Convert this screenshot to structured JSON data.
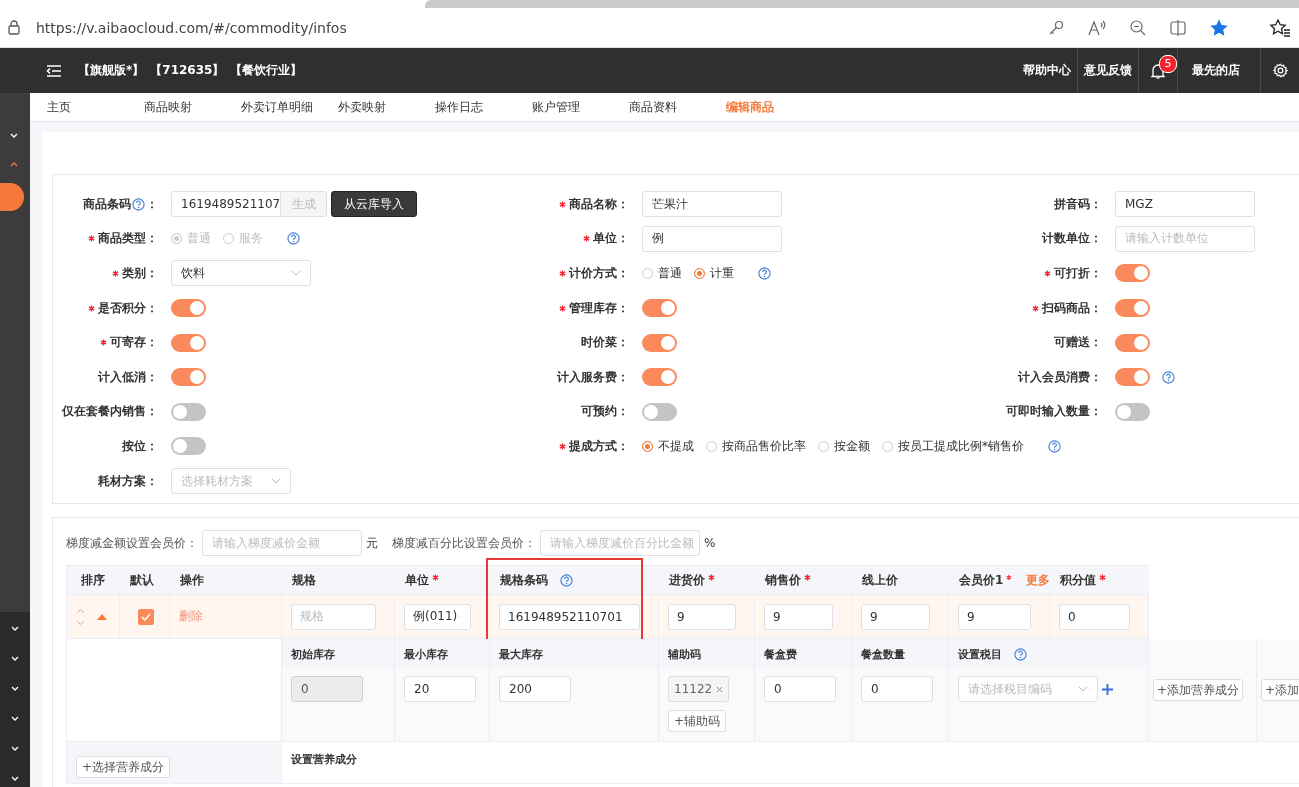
{
  "browser": {
    "url": "https://v.aibaocloud.com/#/commodity/infos"
  },
  "top_nav": {
    "badges": [
      "【旗舰版*】",
      "【712635】",
      "【餐饮行业】"
    ],
    "help": "帮助中心",
    "feedback": "意见反馈",
    "notifications": "5",
    "store": "最先的店"
  },
  "tabs": [
    {
      "label": "主页",
      "selected": false
    },
    {
      "label": "商品映射",
      "selected": false
    },
    {
      "label": "外卖订单明细",
      "selected": false
    },
    {
      "label": "外卖映射",
      "selected": false
    },
    {
      "label": "操作日志",
      "selected": false
    },
    {
      "label": "账户管理",
      "selected": false
    },
    {
      "label": "商品资料",
      "selected": false
    },
    {
      "label": "编辑商品",
      "selected": true
    }
  ],
  "form": {
    "rows": [
      {
        "fields": [
          {
            "kind": "barcode",
            "label": "商品条码",
            "label_suffix": "：",
            "help": true,
            "help_in_label": true,
            "required": false,
            "value": "1619489521107",
            "append": "生成",
            "button": "从云库导入"
          },
          {
            "kind": "text",
            "label": "商品名称：",
            "required": true,
            "value": "芒果汁"
          },
          {
            "kind": "text",
            "label": "拼音码：",
            "required": false,
            "value": "MGZ"
          }
        ]
      },
      {
        "fields": [
          {
            "kind": "radio",
            "label": "商品类型：",
            "required": true,
            "disabled": true,
            "help": true,
            "options": [
              {
                "label": "普通",
                "selected": true
              },
              {
                "label": "服务",
                "selected": false
              }
            ]
          },
          {
            "kind": "text",
            "label": "单位：",
            "required": true,
            "value": "例"
          },
          {
            "kind": "text",
            "label": "计数单位：",
            "required": false,
            "placeholder": "请输入计数单位"
          }
        ]
      },
      {
        "fields": [
          {
            "kind": "select",
            "label": "类别：",
            "required": true,
            "value": "饮料"
          },
          {
            "kind": "radio",
            "label": "计价方式：",
            "required": true,
            "disabled": false,
            "help": true,
            "options": [
              {
                "label": "普通",
                "selected": false
              },
              {
                "label": "计重",
                "selected": true
              }
            ]
          },
          {
            "kind": "toggle",
            "label": "可打折：",
            "required": true,
            "on": true
          }
        ]
      },
      {
        "fields": [
          {
            "kind": "toggle",
            "label": "是否积分：",
            "required": true,
            "on": true
          },
          {
            "kind": "toggle",
            "label": "管理库存：",
            "required": true,
            "on": true
          },
          {
            "kind": "toggle",
            "label": "扫码商品：",
            "required": true,
            "on": true
          }
        ]
      },
      {
        "fields": [
          {
            "kind": "toggle",
            "label": "可寄存：",
            "required": true,
            "on": true
          },
          {
            "kind": "toggle",
            "label": "时价菜：",
            "required": false,
            "on": true
          },
          {
            "kind": "toggle",
            "label": "可赠送：",
            "required": false,
            "on": true
          }
        ]
      },
      {
        "fields": [
          {
            "kind": "toggle",
            "label": "计入低消：",
            "required": false,
            "on": true
          },
          {
            "kind": "toggle",
            "label": "计入服务费：",
            "required": false,
            "on": true
          },
          {
            "kind": "toggle",
            "label": "计入会员消费：",
            "required": false,
            "on": true,
            "help": true
          }
        ]
      },
      {
        "fields": [
          {
            "kind": "toggle",
            "label": "仅在套餐内销售：",
            "required": false,
            "on": false
          },
          {
            "kind": "toggle",
            "label": "可预约：",
            "required": false,
            "on": false
          },
          {
            "kind": "toggle",
            "label": "可即时输入数量：",
            "required": false,
            "on": false
          }
        ]
      },
      {
        "fields": [
          {
            "kind": "toggle",
            "label": "按位：",
            "required": false,
            "on": false
          },
          {
            "kind": "radio",
            "label": "提成方式：",
            "required": true,
            "disabled": false,
            "help": true,
            "options": [
              {
                "label": "不提成",
                "selected": true
              },
              {
                "label": "按商品售价比率",
                "selected": false
              },
              {
                "label": "按金额",
                "selected": false
              },
              {
                "label": "按员工提成比例*销售价",
                "selected": false
              }
            ]
          }
        ]
      },
      {
        "fields": [
          {
            "kind": "select",
            "label": "耗材方案：",
            "required": false,
            "placeholder": "选择耗材方案"
          }
        ]
      }
    ]
  },
  "tiers": {
    "amount_label": "梯度减金额设置会员价：",
    "amount_placeholder": "请输入梯度减价金额",
    "amount_unit": "元",
    "percent_label": "梯度减百分比设置会员价：",
    "percent_placeholder": "请输入梯度减价百分比金额",
    "percent_unit": "%"
  },
  "spec_table": {
    "columns": [
      {
        "label": "排序"
      },
      {
        "label": "默认"
      },
      {
        "label": "操作"
      },
      {
        "label": "规格"
      },
      {
        "label": "单位",
        "required": true
      },
      {
        "label": "规格条码",
        "help": true,
        "highlighted": true
      },
      {
        "label": "进货价",
        "required": true
      },
      {
        "label": "销售价",
        "required": true
      },
      {
        "label": "线上价"
      },
      {
        "label": "会员价1",
        "required": true,
        "link": "更多"
      },
      {
        "label": "积分值",
        "required": true
      }
    ],
    "rows": [
      {
        "cells": [
          {
            "kind": "sort"
          },
          {
            "kind": "check",
            "checked": true
          },
          {
            "kind": "link",
            "text": "删除"
          },
          {
            "kind": "input",
            "placeholder": "规格"
          },
          {
            "kind": "select",
            "value": "例(011)"
          },
          {
            "kind": "input",
            "value": "161948952110701"
          },
          {
            "kind": "input",
            "value": "9"
          },
          {
            "kind": "input",
            "value": "9"
          },
          {
            "kind": "input",
            "value": "9"
          },
          {
            "kind": "input",
            "value": "9"
          },
          {
            "kind": "input",
            "value": "0"
          }
        ]
      }
    ],
    "sub_columns": [
      {
        "kind": "input",
        "label": "初始库存",
        "value": "0",
        "disabled": true
      },
      {
        "kind": "input",
        "label": "最小库存",
        "value": "20",
        "disabled": false
      },
      {
        "kind": "input",
        "label": "最大库存",
        "value": "200",
        "disabled": false
      },
      {
        "kind": "tags",
        "label": "辅助码",
        "tags": [
          "11122"
        ],
        "button": "+辅助码"
      },
      {
        "kind": "input",
        "label": "餐盒费",
        "value": "0",
        "disabled": false
      },
      {
        "kind": "input",
        "label": "餐盒数量",
        "value": "0",
        "disabled": false
      },
      {
        "kind": "select",
        "label": "设置税目",
        "help": true,
        "placeholder": "请选择税目编码"
      }
    ],
    "nutrition_buttons": [
      "+添加营养成分",
      "+添加"
    ],
    "footer": {
      "button": "+选择营养成分",
      "label": "设置营养成分"
    }
  }
}
